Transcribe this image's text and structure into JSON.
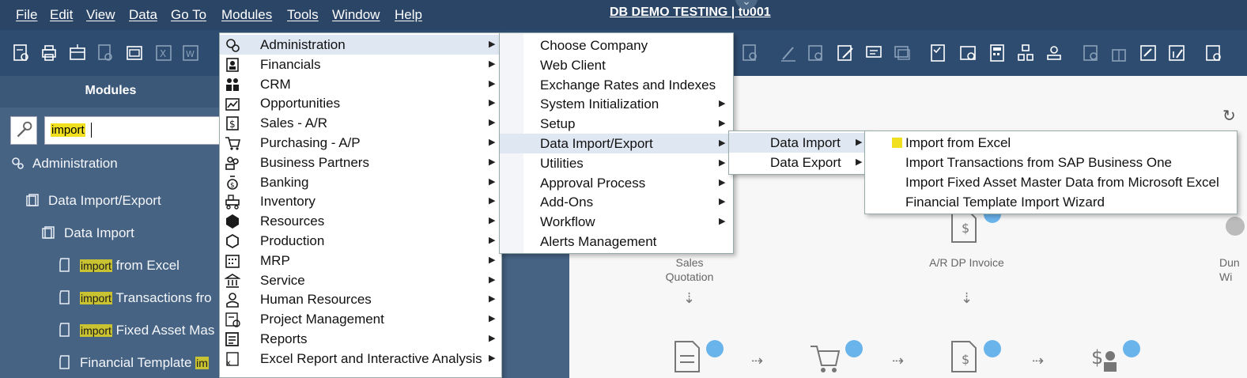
{
  "window_title": "DB DEMO TESTING | t0001",
  "menubar": {
    "items": [
      "File",
      "Edit",
      "View",
      "Data",
      "Go To",
      "Modules",
      "Tools",
      "Window",
      "Help"
    ]
  },
  "left_panel": {
    "header": "Modules",
    "search_value": "import",
    "tree": {
      "administration": "Administration",
      "data_import_export": "Data Import/Export",
      "data_import": "Data Import",
      "item1_hl": "import",
      "item1_rest": " from Excel",
      "item2_hl": "import",
      "item2_rest": " Transactions fro",
      "item3_hl": "import",
      "item3_rest": " Fixed Asset Mas",
      "item4_rest": "Financial Template ",
      "item4_hl": "im"
    }
  },
  "canvas": {
    "sales_quotation_line1": "Sales",
    "sales_quotation_line2": "Quotation",
    "ar_dp_invoice": "A/R DP Invoice",
    "cut_label_line1": "Dun",
    "cut_label_line2": "Wi"
  },
  "modules_menu": {
    "items": [
      {
        "label": "Administration",
        "icon": "administration-icon"
      },
      {
        "label": "Financials",
        "icon": "financials-icon"
      },
      {
        "label": "CRM",
        "icon": "crm-icon"
      },
      {
        "label": "Opportunities",
        "icon": "opportunities-icon"
      },
      {
        "label": "Sales - A/R",
        "icon": "sales-icon"
      },
      {
        "label": "Purchasing - A/P",
        "icon": "cart-icon"
      },
      {
        "label": "Business Partners",
        "icon": "business-partners-icon"
      },
      {
        "label": "Banking",
        "icon": "banking-icon"
      },
      {
        "label": "Inventory",
        "icon": "inventory-icon"
      },
      {
        "label": "Resources",
        "icon": "resources-icon"
      },
      {
        "label": "Production",
        "icon": "production-icon"
      },
      {
        "label": "MRP",
        "icon": "mrp-icon"
      },
      {
        "label": "Service",
        "icon": "service-icon"
      },
      {
        "label": "Human Resources",
        "icon": "person-icon"
      },
      {
        "label": "Project Management",
        "icon": "project-icon"
      },
      {
        "label": "Reports",
        "icon": "reports-icon"
      },
      {
        "label": "Excel Report and Interactive Analysis",
        "icon": "excel-report-icon"
      }
    ]
  },
  "admin_menu": {
    "items": [
      "Choose Company",
      "Web Client",
      "Exchange Rates and Indexes",
      "System Initialization",
      "Setup",
      "Data Import/Export",
      "Utilities",
      "Approval Process",
      "Add-Ons",
      "Workflow",
      "Alerts Management"
    ]
  },
  "data_menu": {
    "items": [
      "Data Import",
      "Data Export"
    ]
  },
  "import_menu": {
    "items": [
      "Import from Excel",
      "Import Transactions from SAP Business One",
      "Import Fixed Asset Master Data from Microsoft Excel",
      "Financial Template Import Wizard"
    ]
  },
  "colors": {
    "menubar": "#2a4566",
    "toolbar": "#2e4c70",
    "panel": "#466384",
    "highlight": "#f0e020",
    "badge": "#6ab4ec"
  }
}
